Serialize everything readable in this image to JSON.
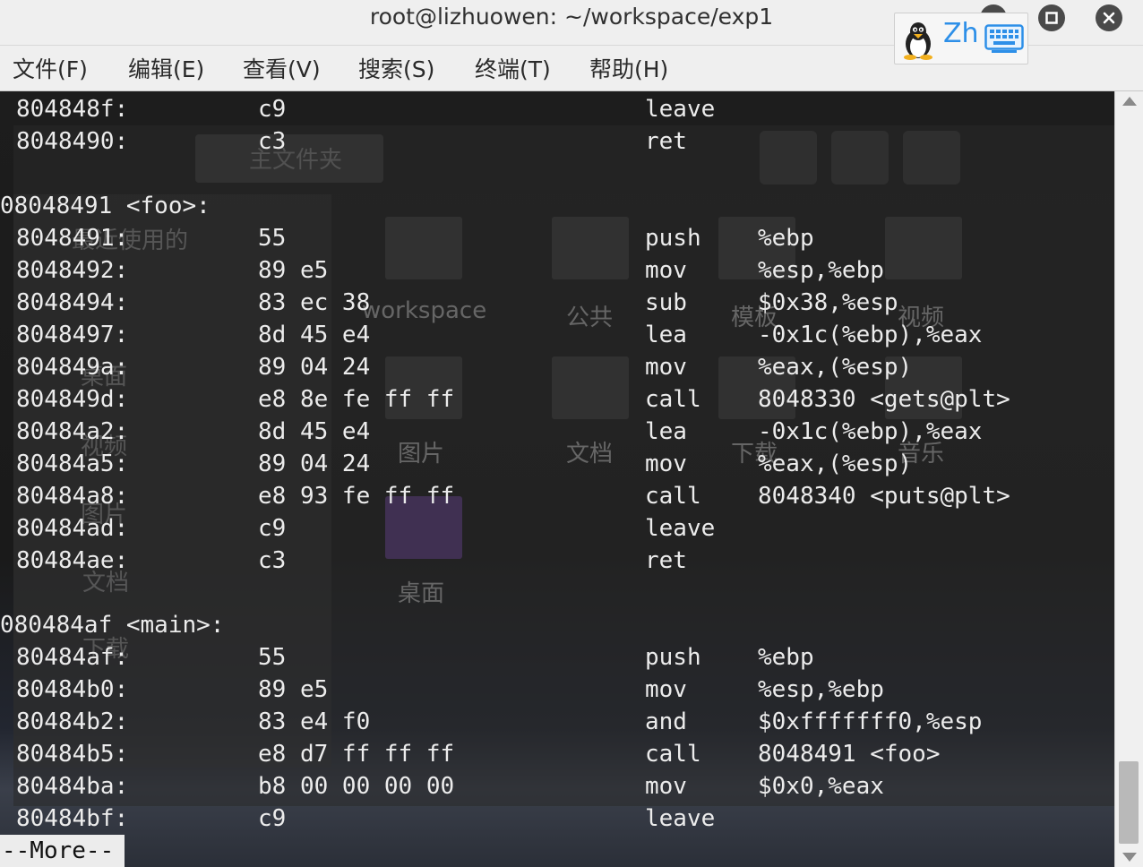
{
  "window": {
    "title": "root@lizhuowen: ~/workspace/exp1",
    "controls": [
      "minimize",
      "maximize",
      "close"
    ]
  },
  "ime": {
    "label": "Zh",
    "icons": [
      "tux-icon",
      "keyboard-icon"
    ]
  },
  "menu": [
    {
      "label": "文件(F)"
    },
    {
      "label": "编辑(E)"
    },
    {
      "label": "查看(V)"
    },
    {
      "label": "搜索(S)"
    },
    {
      "label": "终端(T)"
    },
    {
      "label": "帮助(H)"
    }
  ],
  "background_app": {
    "breadcrumb": "主文件夹",
    "sidebar": [
      "最近使用的",
      "桌面",
      "视频",
      "图片",
      "文档",
      "下载"
    ],
    "folders": [
      "workspace",
      "公共",
      "模板",
      "视频",
      "图片",
      "文档",
      "下载",
      "音乐",
      "桌面"
    ]
  },
  "terminal": {
    "lines": [
      {
        "type": "insn",
        "addr": "804848f:",
        "bytes": "c9",
        "mnemonic": "leave",
        "operands": ""
      },
      {
        "type": "insn",
        "addr": "8048490:",
        "bytes": "c3",
        "mnemonic": "ret",
        "operands": ""
      },
      {
        "type": "blank"
      },
      {
        "type": "label",
        "text": "08048491 <foo>:"
      },
      {
        "type": "insn",
        "addr": "8048491:",
        "bytes": "55",
        "mnemonic": "push",
        "operands": "%ebp"
      },
      {
        "type": "insn",
        "addr": "8048492:",
        "bytes": "89 e5",
        "mnemonic": "mov",
        "operands": "%esp,%ebp"
      },
      {
        "type": "insn",
        "addr": "8048494:",
        "bytes": "83 ec 38",
        "mnemonic": "sub",
        "operands": "$0x38,%esp"
      },
      {
        "type": "insn",
        "addr": "8048497:",
        "bytes": "8d 45 e4",
        "mnemonic": "lea",
        "operands": "-0x1c(%ebp),%eax"
      },
      {
        "type": "insn",
        "addr": "804849a:",
        "bytes": "89 04 24",
        "mnemonic": "mov",
        "operands": "%eax,(%esp)"
      },
      {
        "type": "insn",
        "addr": "804849d:",
        "bytes": "e8 8e fe ff ff",
        "mnemonic": "call",
        "operands": "8048330 <gets@plt>"
      },
      {
        "type": "insn",
        "addr": "80484a2:",
        "bytes": "8d 45 e4",
        "mnemonic": "lea",
        "operands": "-0x1c(%ebp),%eax"
      },
      {
        "type": "insn",
        "addr": "80484a5:",
        "bytes": "89 04 24",
        "mnemonic": "mov",
        "operands": "%eax,(%esp)"
      },
      {
        "type": "insn",
        "addr": "80484a8:",
        "bytes": "e8 93 fe ff ff",
        "mnemonic": "call",
        "operands": "8048340 <puts@plt>"
      },
      {
        "type": "insn",
        "addr": "80484ad:",
        "bytes": "c9",
        "mnemonic": "leave",
        "operands": ""
      },
      {
        "type": "insn",
        "addr": "80484ae:",
        "bytes": "c3",
        "mnemonic": "ret",
        "operands": ""
      },
      {
        "type": "blank"
      },
      {
        "type": "label",
        "text": "080484af <main>:"
      },
      {
        "type": "insn",
        "addr": "80484af:",
        "bytes": "55",
        "mnemonic": "push",
        "operands": "%ebp"
      },
      {
        "type": "insn",
        "addr": "80484b0:",
        "bytes": "89 e5",
        "mnemonic": "mov",
        "operands": "%esp,%ebp"
      },
      {
        "type": "insn",
        "addr": "80484b2:",
        "bytes": "83 e4 f0",
        "mnemonic": "and",
        "operands": "$0xfffffff0,%esp"
      },
      {
        "type": "insn",
        "addr": "80484b5:",
        "bytes": "e8 d7 ff ff ff",
        "mnemonic": "call",
        "operands": "8048491 <foo>"
      },
      {
        "type": "insn",
        "addr": "80484ba:",
        "bytes": "b8 00 00 00 00",
        "mnemonic": "mov",
        "operands": "$0x0,%eax"
      },
      {
        "type": "insn",
        "addr": "80484bf:",
        "bytes": "c9",
        "mnemonic": "leave",
        "operands": ""
      }
    ],
    "pager_prompt": "--More--"
  }
}
